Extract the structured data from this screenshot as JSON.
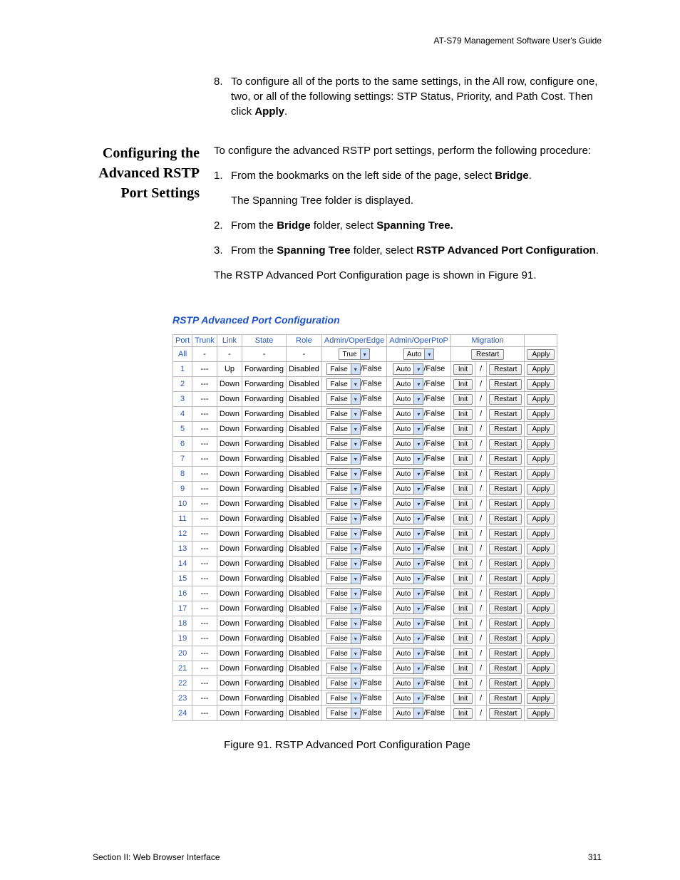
{
  "header": {
    "doc_title": "AT-S79 Management Software User's Guide"
  },
  "intro_step": {
    "num": "8.",
    "text_a": "To configure all of the ports to the same settings, in the All row, configure one, two, or all of the following settings: STP Status, Priority, and Path Cost. Then click ",
    "apply_word": "Apply",
    "text_b": "."
  },
  "section_heading": "Configuring the Advanced RSTP Port Settings",
  "intro_para": "To configure the advanced RSTP port settings, perform the following procedure:",
  "steps": [
    {
      "num": "1.",
      "pre": "From the bookmarks on the left side of the page, select ",
      "bold": "Bridge",
      "post": "."
    },
    {
      "sub": "The Spanning Tree folder is displayed."
    },
    {
      "num": "2.",
      "pre": "From the ",
      "bold": "Bridge",
      "mid": " folder, select ",
      "bold2": "Spanning Tree.",
      "post": ""
    },
    {
      "num": "3.",
      "pre": "From the ",
      "bold": "Spanning Tree",
      "mid": " folder, select ",
      "bold2": "RSTP Advanced Port Configuration",
      "post": "."
    }
  ],
  "result_text": "The RSTP Advanced Port Configuration page is shown in Figure 91.",
  "figure": {
    "title": "RSTP Advanced Port Configuration",
    "caption": "Figure 91. RSTP Advanced Port Configuration Page",
    "headers": [
      "Port",
      "Trunk",
      "Link",
      "State",
      "Role",
      "Admin/OperEdge",
      "Admin/OperPtoP",
      "Migration",
      ""
    ],
    "all_row": {
      "port": "All",
      "trunk": "-",
      "link": "-",
      "state": "-",
      "role": "-",
      "edge_sel": "True",
      "ptop_sel": "Auto",
      "restart": "Restart",
      "apply": "Apply"
    },
    "row_defaults": {
      "trunk": "---",
      "state": "Forwarding",
      "role": "Disabled",
      "edge_sel": "False",
      "edge_oper": "/False",
      "ptop_sel": "Auto",
      "ptop_oper": "/False",
      "mig_a": "Init",
      "mig_sep": "/",
      "mig_b": "Restart",
      "apply": "Apply"
    },
    "rows": [
      {
        "port": "1",
        "link": "Up"
      },
      {
        "port": "2",
        "link": "Down"
      },
      {
        "port": "3",
        "link": "Down"
      },
      {
        "port": "4",
        "link": "Down"
      },
      {
        "port": "5",
        "link": "Down"
      },
      {
        "port": "6",
        "link": "Down"
      },
      {
        "port": "7",
        "link": "Down"
      },
      {
        "port": "8",
        "link": "Down"
      },
      {
        "port": "9",
        "link": "Down"
      },
      {
        "port": "10",
        "link": "Down"
      },
      {
        "port": "11",
        "link": "Down"
      },
      {
        "port": "12",
        "link": "Down"
      },
      {
        "port": "13",
        "link": "Down"
      },
      {
        "port": "14",
        "link": "Down"
      },
      {
        "port": "15",
        "link": "Down"
      },
      {
        "port": "16",
        "link": "Down"
      },
      {
        "port": "17",
        "link": "Down"
      },
      {
        "port": "18",
        "link": "Down"
      },
      {
        "port": "19",
        "link": "Down"
      },
      {
        "port": "20",
        "link": "Down"
      },
      {
        "port": "21",
        "link": "Down"
      },
      {
        "port": "22",
        "link": "Down"
      },
      {
        "port": "23",
        "link": "Down"
      },
      {
        "port": "24",
        "link": "Down"
      }
    ]
  },
  "footer": {
    "left": "Section II: Web Browser Interface",
    "right": "311"
  }
}
